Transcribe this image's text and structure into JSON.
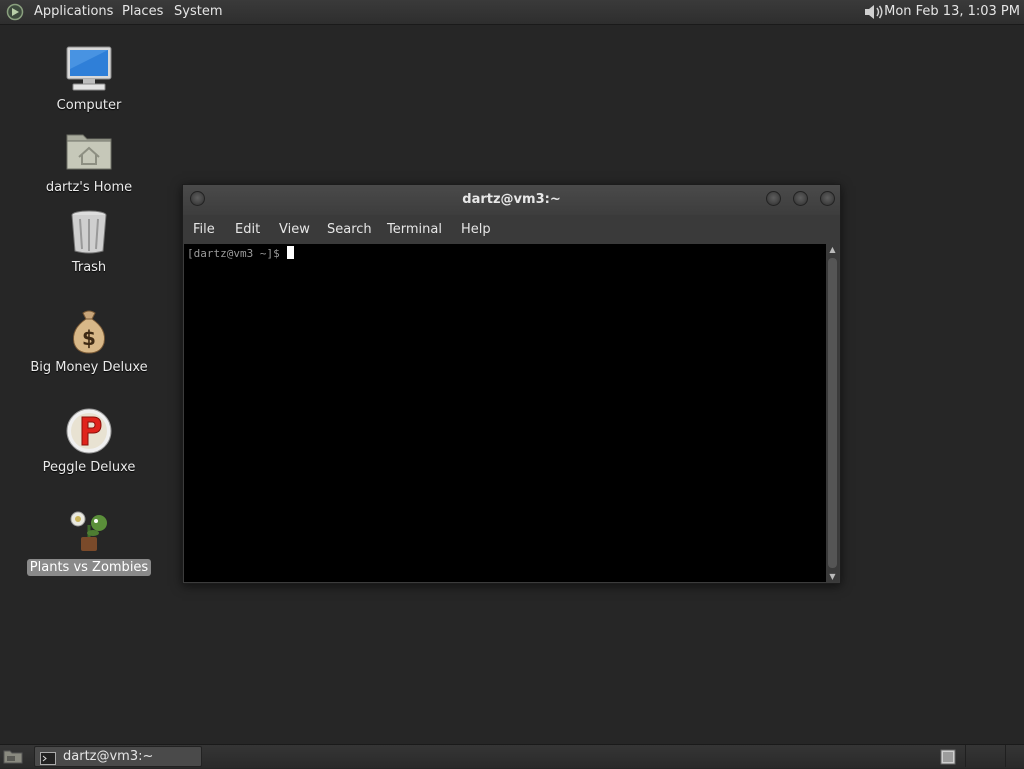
{
  "top_panel": {
    "menus": [
      "Applications",
      "Places",
      "System"
    ],
    "volume_icon": "speaker-icon",
    "clock": "Mon Feb 13,  1:03 PM"
  },
  "desktop": {
    "icons": [
      {
        "label": "Computer",
        "icon": "computer-icon"
      },
      {
        "label": "dartz's Home",
        "icon": "home-folder-icon"
      },
      {
        "label": "Trash",
        "icon": "trash-icon"
      },
      {
        "label": "Big Money Deluxe",
        "icon": "money-bag-icon"
      },
      {
        "label": "Peggle Deluxe",
        "icon": "peggle-icon"
      },
      {
        "label": "Plants vs Zombies",
        "icon": "plants-vs-zombies-icon",
        "selected": true
      }
    ]
  },
  "terminal_window": {
    "title": "dartz@vm3:~",
    "menus": [
      "File",
      "Edit",
      "View",
      "Search",
      "Terminal",
      "Help"
    ],
    "prompt": "[dartz@vm3 ~]$ "
  },
  "bottom_panel": {
    "show_desktop_icon": "show-desktop-icon",
    "task_label": "dartz@vm3:~",
    "workspace_icon": "workspace-switcher-icon"
  },
  "colors": {
    "desktop_bg": "#262626",
    "panel_bg": "#2e2e2e",
    "terminal_bg": "#000000",
    "selection": "#8a8a8a"
  }
}
